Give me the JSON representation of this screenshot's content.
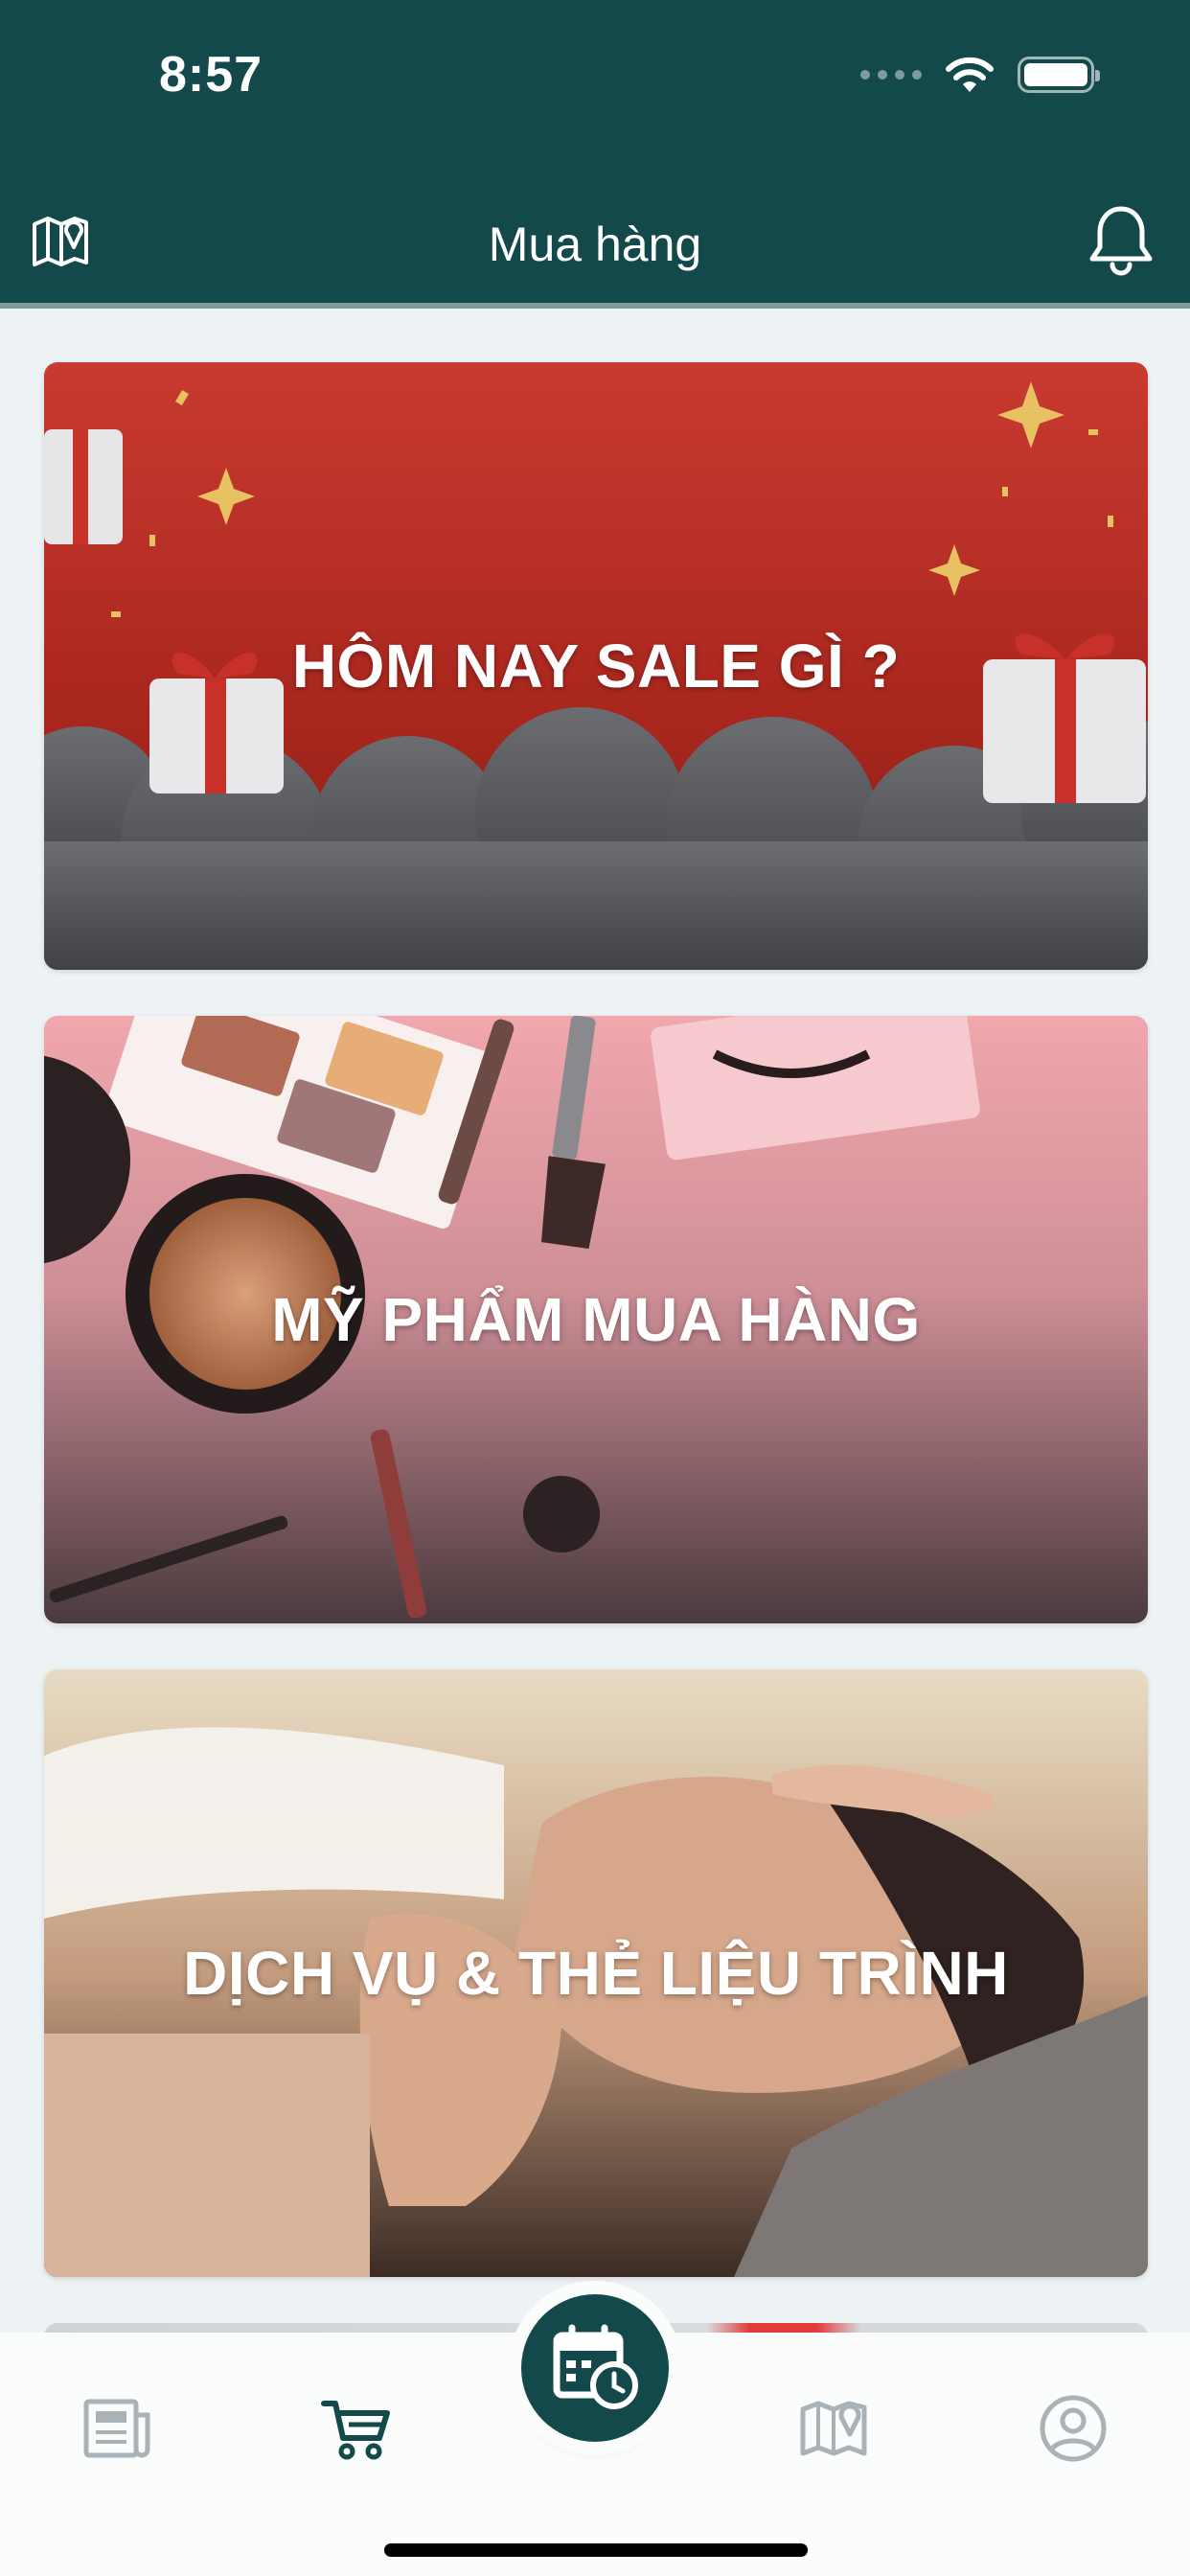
{
  "status_bar": {
    "time": "8:57"
  },
  "header": {
    "title": "Mua hàng",
    "left_icon": "map-pin-icon",
    "right_icon": "bell-icon"
  },
  "cards": [
    {
      "title": "HÔM NAY SALE GÌ ?",
      "theme": "christmas-gifts"
    },
    {
      "title": "MỸ PHẨM MUA HÀNG",
      "theme": "cosmetics"
    },
    {
      "title": "DỊCH VỤ & THẺ LIỆU TRÌNH",
      "theme": "spa-facial"
    }
  ],
  "tab_bar": {
    "items": [
      {
        "icon": "newspaper-icon",
        "active": false
      },
      {
        "icon": "cart-icon",
        "active": true
      },
      {
        "icon": "calendar-clock-icon",
        "center": true
      },
      {
        "icon": "map-pin-icon",
        "active": false
      },
      {
        "icon": "user-circle-icon",
        "active": false
      }
    ]
  },
  "colors": {
    "primary": "#14494c",
    "background": "#edf2f5",
    "tab_inactive": "#a9b2b6",
    "tab_active": "#14494c"
  }
}
